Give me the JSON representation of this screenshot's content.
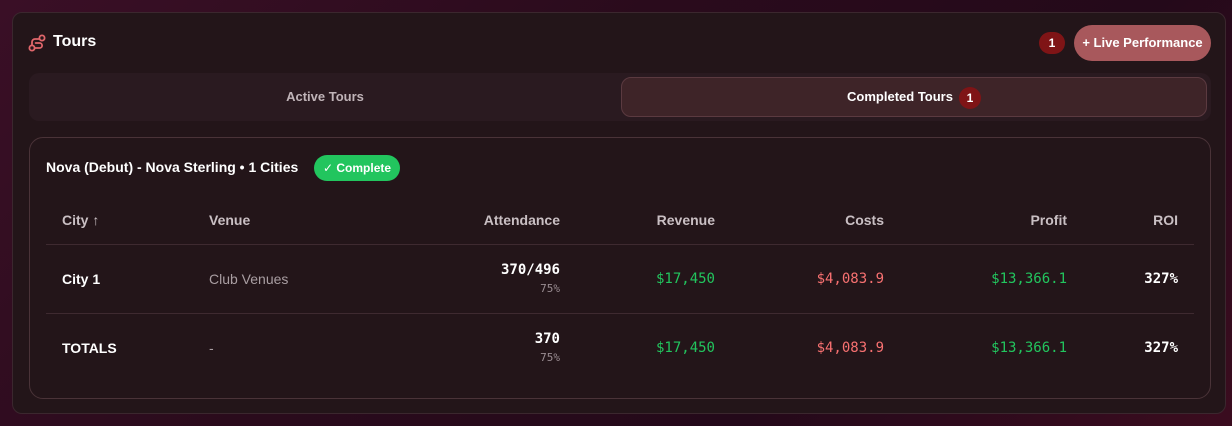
{
  "header": {
    "title": "Tours",
    "count": "1",
    "live_button": "+ Live Performance"
  },
  "tabs": [
    {
      "label": "Active Tours",
      "active": false
    },
    {
      "label": "Completed Tours",
      "active": true,
      "badge": "1"
    }
  ],
  "tour": {
    "name": "Nova (Debut) - Nova Sterling • 1 Cities",
    "status": "✓ Complete",
    "columns": [
      "City ↑",
      "Venue",
      "Attendance",
      "Revenue",
      "Costs",
      "Profit",
      "ROI"
    ],
    "rows": [
      {
        "city": "City 1",
        "venue": "Club Venues",
        "attendance": "370/496",
        "attendance_pct": "75%",
        "revenue": "$17,450",
        "costs": "$4,083.9",
        "profit": "$13,366.1",
        "roi": "327%"
      }
    ],
    "totals": {
      "city": "TOTALS",
      "venue": "-",
      "attendance": "370",
      "attendance_pct": "75%",
      "revenue": "$17,450",
      "costs": "$4,083.9",
      "profit": "$13,366.1",
      "roi": "327%"
    }
  },
  "colors": {
    "accent": "#a8585c",
    "badge": "#7f1416",
    "complete": "#22c55e",
    "positive": "#22c55e",
    "negative": "#f87171"
  },
  "icons": {
    "title": "route-icon"
  }
}
